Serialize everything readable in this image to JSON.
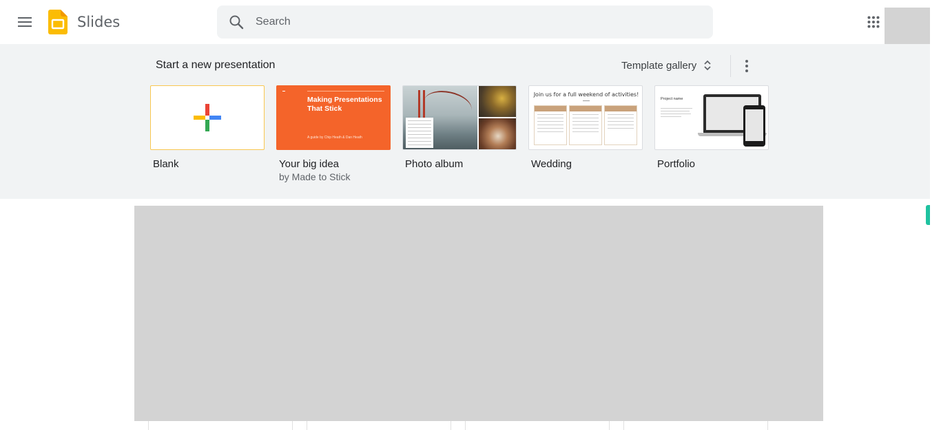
{
  "header": {
    "menu_icon": "hamburger-menu-icon",
    "app_name": "Slides",
    "logo_color": "#FBBC04",
    "search": {
      "placeholder": "Search",
      "value": ""
    },
    "apps_icon": "apps-grid-icon"
  },
  "templates": {
    "title": "Start a new presentation",
    "gallery_label": "Template gallery",
    "items": [
      {
        "label": "Blank",
        "sub": ""
      },
      {
        "label": "Your big idea",
        "sub": "by Made to Stick",
        "thumb_title": "Making Presentations That Stick",
        "thumb_sub": "A guide by Chip Heath & Dan Heath"
      },
      {
        "label": "Photo album",
        "sub": ""
      },
      {
        "label": "Wedding",
        "sub": "",
        "thumb_title": "Join us for a full weekend of activities!"
      },
      {
        "label": "Portfolio",
        "sub": "",
        "thumb_title": "Project name"
      }
    ]
  },
  "colors": {
    "accent_blue": "#4285F4",
    "accent_red": "#EA4335",
    "accent_yellow": "#FBBC04",
    "accent_green": "#34A853",
    "template_orange": "#F4642A",
    "side_pill": "#1FC2A0"
  }
}
